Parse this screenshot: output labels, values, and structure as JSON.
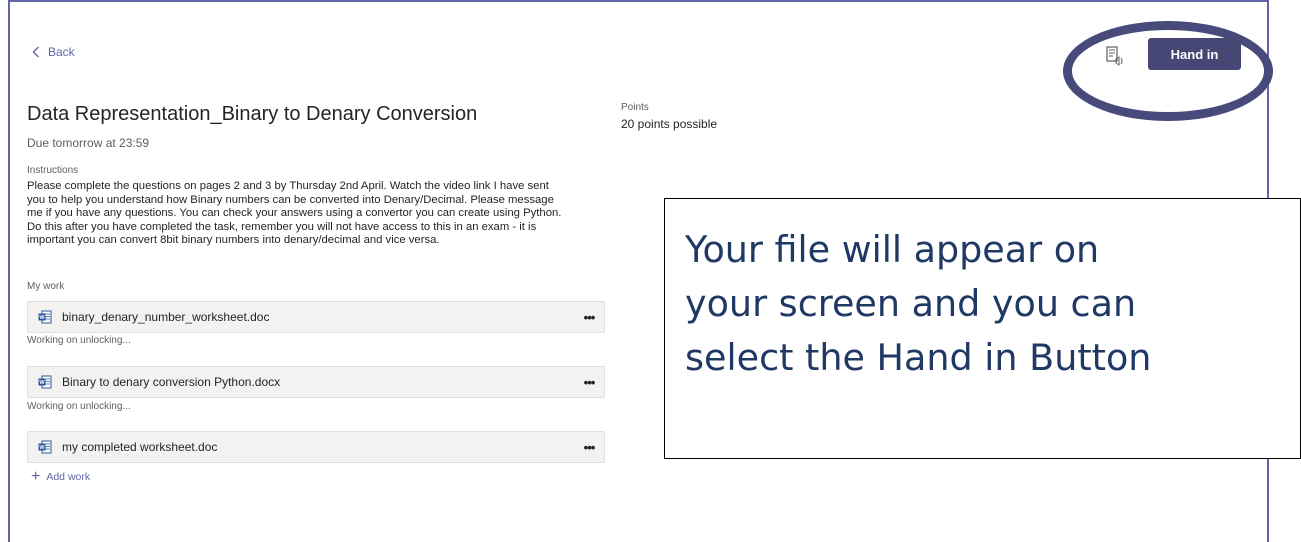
{
  "nav": {
    "back_label": "Back"
  },
  "header": {
    "immersive_reader_icon": "immersive-reader-icon",
    "hand_in_label": "Hand in",
    "highlight_color": "#474a7a",
    "button_color": "#464775"
  },
  "assignment": {
    "title": "Data Representation_Binary to Denary Conversion",
    "due": "Due tomorrow at 23:59",
    "points_label": "Points",
    "points_value": "20 points possible",
    "instructions_label": "Instructions",
    "instructions_lines": [
      "Please complete the questions on pages 2 and 3 by Thursday 2nd April. Watch the video link I have sent",
      "you to help you understand how Binary numbers can be converted into Denary/Decimal.  Please message",
      "me if you have any questions. You can check your answers using a convertor you can create using Python.",
      "Do this after you have completed the task, remember you will not have access to this in an exam - it is",
      "important you can convert 8bit binary numbers into denary/decimal and vice versa."
    ]
  },
  "my_work": {
    "label": "My work",
    "files": [
      {
        "name": "binary_denary_number_worksheet.doc",
        "status": "Working on unlocking...",
        "icon": "word-doc-icon"
      },
      {
        "name": "Binary to denary conversion Python.docx",
        "status": "Working on unlocking...",
        "icon": "word-doc-icon"
      },
      {
        "name": "my completed worksheet.doc",
        "status": "",
        "icon": "word-doc-icon"
      }
    ],
    "more_label": "•••",
    "add_work_label": "Add work"
  },
  "callout": {
    "lines": [
      "Your file will appear on",
      "your screen and you can",
      "select the Hand in Button"
    ],
    "text_color": "#1f3864"
  }
}
